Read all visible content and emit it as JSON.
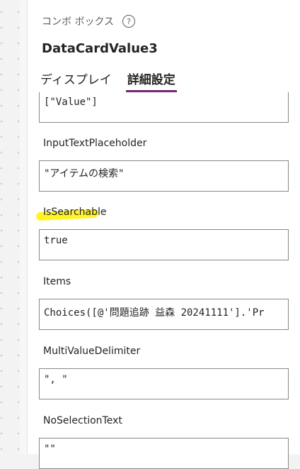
{
  "header": {
    "control_type": "コンボ ボックス",
    "control_name": "DataCardValue3"
  },
  "tabs": [
    {
      "label": "ディスプレイ",
      "active": false
    },
    {
      "label": "詳細設定",
      "active": true
    }
  ],
  "properties": [
    {
      "name": "",
      "value": "[\"Value\"]"
    },
    {
      "name": "InputTextPlaceholder",
      "value": "\"アイテムの検索\""
    },
    {
      "name": "IsSearchable",
      "value": "true"
    },
    {
      "name": "Items",
      "value": "Choices([@'問題追跡 益森 20241111'].'Pr"
    },
    {
      "name": "MultiValueDelimiter",
      "value": "\", \""
    },
    {
      "name": "NoSelectionText",
      "value": "\"\""
    }
  ],
  "colors": {
    "active_tab_underline": "#742774",
    "highlighter": "#fff200"
  }
}
